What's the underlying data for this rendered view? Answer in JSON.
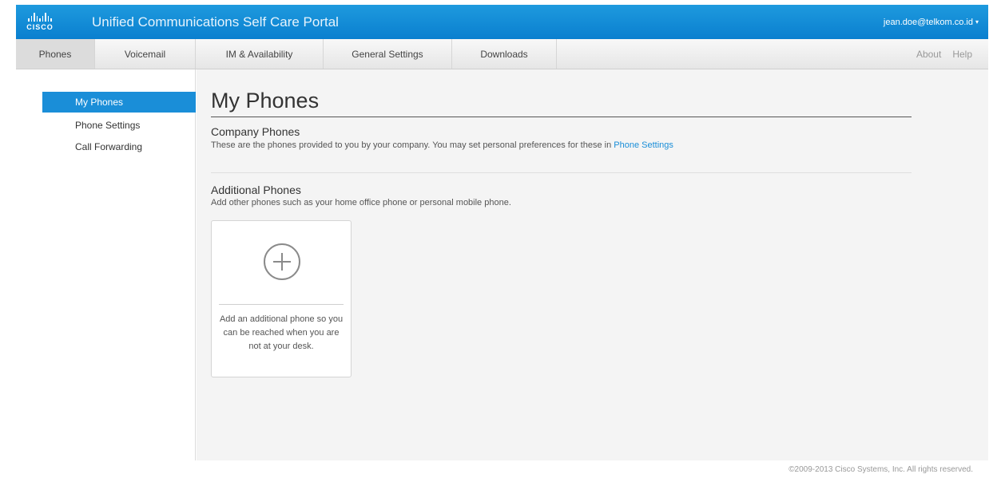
{
  "header": {
    "logo_text": "CISCO",
    "title": "Unified Communications Self Care Portal",
    "user": "jean.doe@telkom.co.id",
    "user_caret": "▾"
  },
  "nav": {
    "tabs": [
      {
        "label": "Phones"
      },
      {
        "label": "Voicemail"
      },
      {
        "label": "IM & Availability"
      },
      {
        "label": "General Settings"
      },
      {
        "label": "Downloads"
      }
    ],
    "about": "About",
    "help": "Help"
  },
  "sidebar": {
    "items": [
      {
        "label": "My Phones"
      },
      {
        "label": "Phone Settings"
      },
      {
        "label": "Call Forwarding"
      }
    ]
  },
  "main": {
    "title": "My Phones",
    "company": {
      "title": "Company Phones",
      "desc": "These are the phones provided to you by your company. You may set personal preferences for these in ",
      "link": "Phone Settings"
    },
    "additional": {
      "title": "Additional Phones",
      "desc": "Add other phones such as your home office phone or personal mobile phone.",
      "card_text": "Add an additional phone so you can be reached when you are not at your desk."
    }
  },
  "footer": {
    "copyright": "©2009-2013 Cisco Systems, Inc. All rights reserved."
  },
  "colors": {
    "header_blue": "#0a7fcf",
    "accent_blue": "#1a8ed8"
  },
  "icons": [
    "cisco-logo-icon",
    "chevron-down-icon",
    "add-circle-icon"
  ]
}
